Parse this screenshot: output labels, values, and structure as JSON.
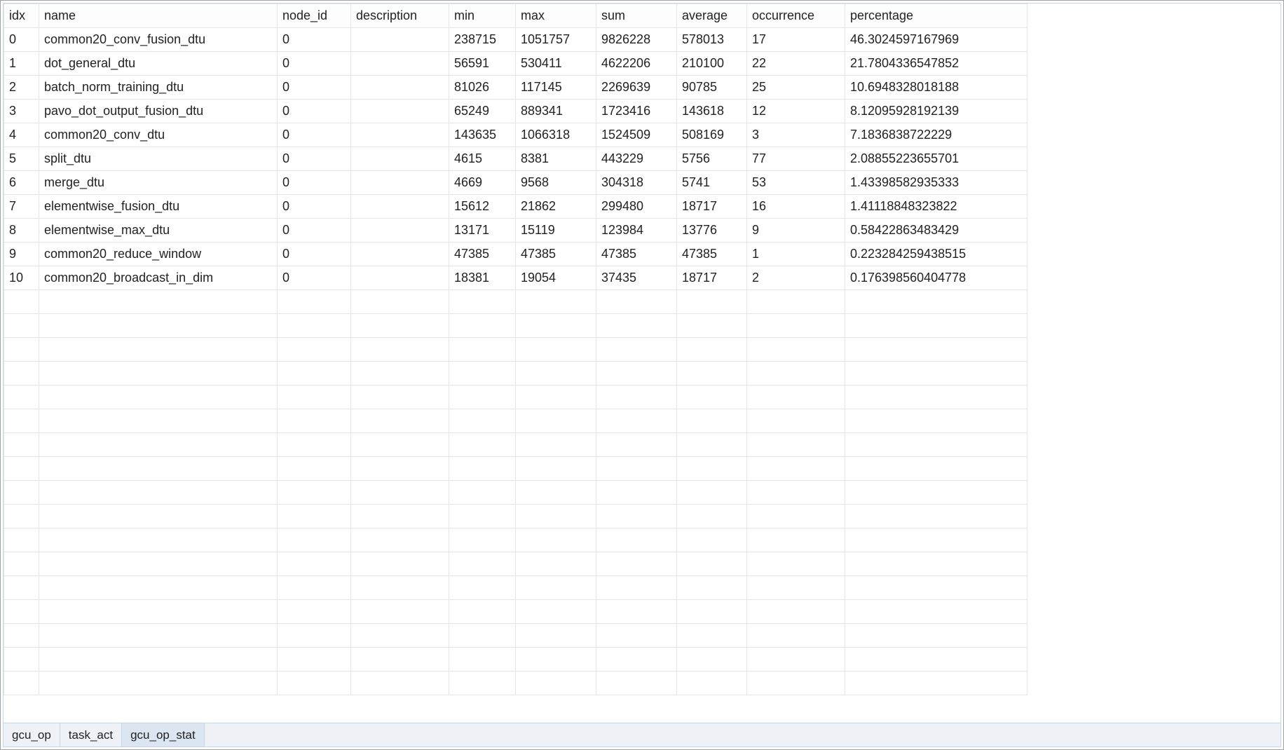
{
  "table": {
    "headers": {
      "idx": "idx",
      "name": "name",
      "node_id": "node_id",
      "description": "description",
      "min": "min",
      "max": "max",
      "sum": "sum",
      "average": "average",
      "occurrence": "occurrence",
      "percentage": "percentage"
    },
    "rows": [
      {
        "idx": "0",
        "name": "common20_conv_fusion_dtu",
        "node_id": "0",
        "description": "",
        "min": "238715",
        "max": "1051757",
        "sum": "9826228",
        "average": "578013",
        "occurrence": "17",
        "percentage": "46.3024597167969"
      },
      {
        "idx": "1",
        "name": "dot_general_dtu",
        "node_id": "0",
        "description": "",
        "min": "56591",
        "max": "530411",
        "sum": "4622206",
        "average": "210100",
        "occurrence": "22",
        "percentage": "21.7804336547852"
      },
      {
        "idx": "2",
        "name": "batch_norm_training_dtu",
        "node_id": "0",
        "description": "",
        "min": "81026",
        "max": "117145",
        "sum": "2269639",
        "average": "90785",
        "occurrence": "25",
        "percentage": "10.6948328018188"
      },
      {
        "idx": "3",
        "name": "pavo_dot_output_fusion_dtu",
        "node_id": "0",
        "description": "",
        "min": "65249",
        "max": "889341",
        "sum": "1723416",
        "average": "143618",
        "occurrence": "12",
        "percentage": "8.12095928192139"
      },
      {
        "idx": "4",
        "name": "common20_conv_dtu",
        "node_id": "0",
        "description": "",
        "min": "143635",
        "max": "1066318",
        "sum": "1524509",
        "average": "508169",
        "occurrence": "3",
        "percentage": "7.1836838722229"
      },
      {
        "idx": "5",
        "name": "split_dtu",
        "node_id": "0",
        "description": "",
        "min": "4615",
        "max": "8381",
        "sum": "443229",
        "average": "5756",
        "occurrence": "77",
        "percentage": "2.08855223655701"
      },
      {
        "idx": "6",
        "name": "merge_dtu",
        "node_id": "0",
        "description": "",
        "min": "4669",
        "max": "9568",
        "sum": "304318",
        "average": "5741",
        "occurrence": "53",
        "percentage": "1.43398582935333"
      },
      {
        "idx": "7",
        "name": "elementwise_fusion_dtu",
        "node_id": "0",
        "description": "",
        "min": "15612",
        "max": "21862",
        "sum": "299480",
        "average": "18717",
        "occurrence": "16",
        "percentage": "1.41118848323822"
      },
      {
        "idx": "8",
        "name": "elementwise_max_dtu",
        "node_id": "0",
        "description": "",
        "min": "13171",
        "max": "15119",
        "sum": "123984",
        "average": "13776",
        "occurrence": "9",
        "percentage": "0.58422863483429"
      },
      {
        "idx": "9",
        "name": "common20_reduce_window",
        "node_id": "0",
        "description": "",
        "min": "47385",
        "max": "47385",
        "sum": "47385",
        "average": "47385",
        "occurrence": "1",
        "percentage": "0.223284259438515"
      },
      {
        "idx": "10",
        "name": "common20_broadcast_in_dim",
        "node_id": "0",
        "description": "",
        "min": "18381",
        "max": "19054",
        "sum": "37435",
        "average": "18717",
        "occurrence": "2",
        "percentage": "0.176398560404778"
      }
    ]
  },
  "tabs": {
    "gcu_op": "gcu_op",
    "task_act": "task_act",
    "gcu_op_stat": "gcu_op_stat"
  }
}
